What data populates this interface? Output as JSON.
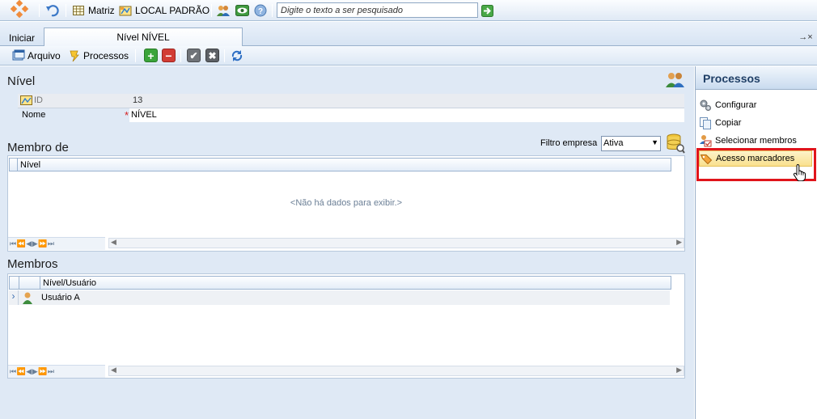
{
  "topbar": {
    "matriz_label": "Matriz",
    "local_label": "LOCAL PADRÃO",
    "search_placeholder": "Digite o texto a ser pesquisado"
  },
  "tabs": {
    "home": "Iniciar",
    "active": "Nível NÍVEL",
    "controls": "→×"
  },
  "toolbar": {
    "arquivo": "Arquivo",
    "processos": "Processos"
  },
  "form": {
    "title": "Nível",
    "id_label": "ID",
    "id_value": "13",
    "name_label": "Nome",
    "required_mark": "*",
    "name_value": "NÍVEL"
  },
  "membro_de": {
    "title": "Membro de",
    "filter_label": "Filtro empresa",
    "filter_value": "Ativa",
    "column": "Nível",
    "empty_text": "<Não há dados para exibir.>",
    "pager": "⏮ ⏪ ◀ ▶ ⏩ ⏭"
  },
  "membros": {
    "title": "Membros",
    "column": "Nível/Usuário",
    "rows": [
      {
        "name": "Usuário A",
        "icon": "user-icon"
      }
    ],
    "pager": "⏮ ⏪ ◀ ▶ ⏩ ⏭"
  },
  "panel": {
    "title": "Processos",
    "items": [
      {
        "label": "Configurar",
        "icon": "gears-icon"
      },
      {
        "label": "Copiar",
        "icon": "copy-icon"
      },
      {
        "label": "Selecionar membros",
        "icon": "select-members-icon"
      },
      {
        "label": "Acesso marcadores",
        "icon": "tag-icon"
      }
    ],
    "highlight_color": "#e0141b"
  }
}
